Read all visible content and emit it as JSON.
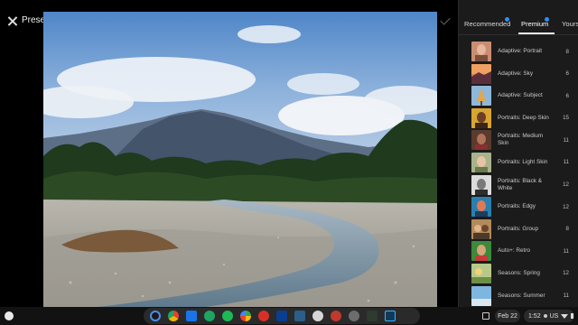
{
  "header": {
    "title": "Presets"
  },
  "tabs": [
    {
      "label": "Recommended",
      "has_dot": true
    },
    {
      "label": "Premium",
      "has_dot": true,
      "selected": true
    },
    {
      "label": "Yours",
      "has_dot": false
    }
  ],
  "presets": [
    {
      "name": "Adaptive: Portrait",
      "count": "8"
    },
    {
      "name": "Adaptive: Sky",
      "count": "6"
    },
    {
      "name": "Adaptive: Subject",
      "count": "6"
    },
    {
      "name": "Portraits: Deep Skin",
      "count": "15"
    },
    {
      "name": "Portraits: Medium Skin",
      "count": "11"
    },
    {
      "name": "Portraits: Light Skin",
      "count": "11"
    },
    {
      "name": "Portraits: Black & White",
      "count": "12"
    },
    {
      "name": "Portraits: Edgy",
      "count": "12"
    },
    {
      "name": "Portraits: Group",
      "count": "8"
    },
    {
      "name": "Auto+: Retro",
      "count": "11"
    },
    {
      "name": "Seasons: Spring",
      "count": "12"
    },
    {
      "name": "Seasons: Summer",
      "count": "11"
    }
  ],
  "shelf": {
    "date": "Feb 22",
    "time": "1:52",
    "region": "US",
    "apps": [
      "launcher-circle-icon",
      "chrome-icon",
      "files-icon",
      "meet-icon",
      "spotify-icon",
      "play-store-icon",
      "app-icon",
      "photoshop-express-icon",
      "app-icon",
      "app-icon",
      "app-icon",
      "settings-icon",
      "terminal-icon",
      "lightroom-icon"
    ]
  },
  "colors": {
    "accent_blue": "#2f8df5",
    "panel_bg": "#1b1b1b"
  }
}
